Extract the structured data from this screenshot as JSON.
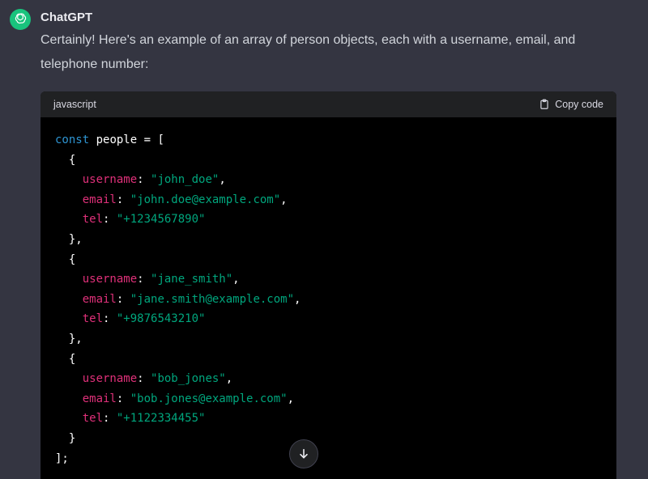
{
  "author": "ChatGPT",
  "message": "Certainly! Here's an example of an array of person objects, each with a username, email, and telephone number:",
  "code_block": {
    "language": "javascript",
    "copy_label": "Copy code",
    "declaration": {
      "keyword": "const",
      "name": "people",
      "operator": " = ",
      "open": "["
    },
    "people": [
      {
        "username": "\"john_doe\"",
        "email": "\"john.doe@example.com\"",
        "tel": "\"+1234567890\""
      },
      {
        "username": "\"jane_smith\"",
        "email": "\"jane.smith@example.com\"",
        "tel": "\"+9876543210\""
      },
      {
        "username": "\"bob_jones\"",
        "email": "\"bob.jones@example.com\"",
        "tel": "\"+1122334455\""
      }
    ],
    "keys": {
      "username": "username",
      "email": "email",
      "tel": "tel"
    },
    "closing": "];"
  },
  "icons": {
    "avatar": "openai-logo-icon",
    "copy": "clipboard-icon",
    "scroll": "arrow-down-icon"
  },
  "colors": {
    "background": "#343541",
    "avatar": "#19c37d",
    "keyword": "#2e95d3",
    "property": "#df3079",
    "string": "#00a67d"
  }
}
